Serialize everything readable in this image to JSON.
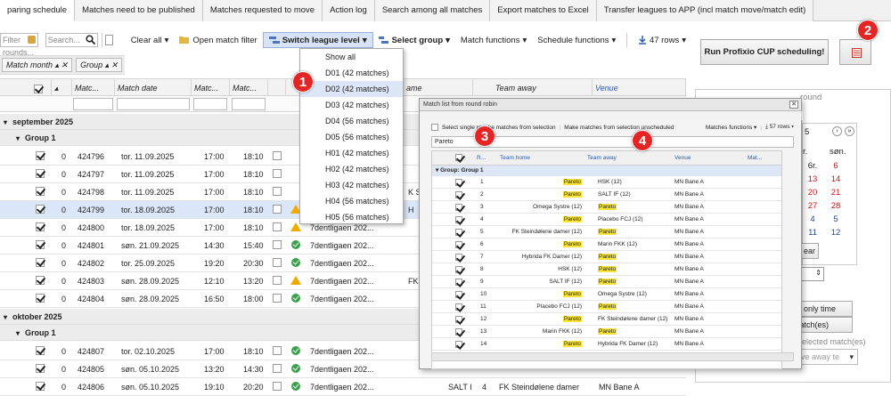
{
  "tabs": [
    "paring schedule",
    "Matches need to be published",
    "Matches requested to move",
    "Action log",
    "Search among all matches",
    "Export matches to Excel",
    "Transfer leagues to APP (incl match move/match edit)"
  ],
  "toolbar": {
    "filter_rounds_placeholder": "Filter rounds...",
    "search_placeholder": "Search...",
    "clear_all": "Clear all",
    "open_match_filter": "Open match filter",
    "switch_league_level": "Switch league level",
    "select_group": "Select group",
    "match_functions": "Match functions",
    "schedule_functions": "Schedule functions",
    "row_count": "47 rows"
  },
  "grouping": {
    "chip1": "Match month",
    "chip2": "Group"
  },
  "columns": {
    "match": "Matc...",
    "match_date": "Match date",
    "match_time": "Matc...",
    "match_end": "Matc...",
    "home_partial": "ame",
    "team_away": "Team away",
    "venue": "Venue"
  },
  "months": [
    "september 2025",
    "oktober 2025"
  ],
  "group_label": "Group 1",
  "rows": [
    {
      "n": "0",
      "id": "424796",
      "date": "tor. 11.09.2025",
      "t1": "17:00",
      "t2": "18:10",
      "status": "",
      "league": "",
      "away": ""
    },
    {
      "n": "0",
      "id": "424797",
      "date": "tor. 11.09.2025",
      "t1": "17:00",
      "t2": "18:10",
      "status": "",
      "league": "",
      "away": ""
    },
    {
      "n": "0",
      "id": "424798",
      "date": "tor. 11.09.2025",
      "t1": "17:00",
      "t2": "18:10",
      "status": "",
      "league": "",
      "away": "K Ste"
    },
    {
      "n": "0",
      "id": "424799",
      "date": "tor. 18.09.2025",
      "t1": "17:00",
      "t2": "18:10",
      "status": "warn",
      "league": "",
      "away": "H"
    },
    {
      "n": "0",
      "id": "424800",
      "date": "tor. 18.09.2025",
      "t1": "17:00",
      "t2": "18:10",
      "status": "warn",
      "league": "7dentligaen 202...",
      "away": ""
    },
    {
      "n": "0",
      "id": "424801",
      "date": "søn. 21.09.2025",
      "t1": "14:30",
      "t2": "15:40",
      "status": "ok",
      "league": "7dentligaen 202...",
      "away": ""
    },
    {
      "n": "0",
      "id": "424802",
      "date": "tor. 25.09.2025",
      "t1": "19:20",
      "t2": "20:30",
      "status": "ok",
      "league": "7dentligaen 202...",
      "away": ""
    },
    {
      "n": "0",
      "id": "424803",
      "date": "søn. 28.09.2025",
      "t1": "12:10",
      "t2": "13:20",
      "status": "warn",
      "league": "7dentligaen 202...",
      "away": "FK Ste"
    },
    {
      "n": "0",
      "id": "424804",
      "date": "søn. 28.09.2025",
      "t1": "16:50",
      "t2": "18:00",
      "status": "ok",
      "league": "7dentligaen 202...",
      "away": ""
    },
    {
      "n": "0",
      "id": "424807",
      "date": "tor. 02.10.2025",
      "t1": "17:00",
      "t2": "18:10",
      "status": "ok",
      "league": "7dentligaen 202...",
      "away": ""
    },
    {
      "n": "0",
      "id": "424805",
      "date": "søn. 05.10.2025",
      "t1": "13:20",
      "t2": "14:30",
      "status": "ok",
      "league": "7dentligaen 202...",
      "away": ""
    },
    {
      "n": "0",
      "id": "424806",
      "date": "søn. 05.10.2025",
      "t1": "19:10",
      "t2": "20:20",
      "status": "ok",
      "league": "7dentligaen 202...",
      "away": "SALT IF"
    }
  ],
  "last_row_extra": {
    "num": "4",
    "away": "FK Steindølene damer",
    "venue": "MN Bane A"
  },
  "dropdown": [
    "Show all",
    "D01 (42 matches)",
    "D02 (42 matches)",
    "D03 (42 matches)",
    "D04 (56 matches)",
    "D05 (56 matches)",
    "H01 (42 matches)",
    "H02 (42 matches)",
    "H03 (42 matches)",
    "H04 (56 matches)",
    "H05 (56 matches)"
  ],
  "badges": [
    "1",
    "2",
    "3",
    "4"
  ],
  "run_button": "Run Profixio CUP scheduling!",
  "popup": {
    "title": "Match list from round robin",
    "select_single": "Select single ro",
    "make_from_sel": "ake matches from selection",
    "make_unsched": "Make matches from selection unscheduled",
    "functions": "Matches functions",
    "rows": "57 rows",
    "search": "Pareto",
    "headers": [
      "R...",
      "Team home",
      "Team away",
      "Venue",
      "Mat..."
    ],
    "group": "Group: Group 1",
    "matches": [
      {
        "r": "1",
        "home": "Pareto",
        "away": "HSK (12)",
        "venue": "MN Bane A"
      },
      {
        "r": "2",
        "home": "Pareto",
        "away": "SALT IF (12)",
        "venue": "MN Bane A"
      },
      {
        "r": "3",
        "home": "Omega Systre (12)",
        "away": "Pareto",
        "venue": "MN Bane A"
      },
      {
        "r": "4",
        "home": "Pareto",
        "away": "Placebo FCJ (12)",
        "venue": "MN Bane A"
      },
      {
        "r": "5",
        "home": "FK Steindølene damer (12)",
        "away": "Pareto",
        "venue": "MN Bane A"
      },
      {
        "r": "6",
        "home": "Pareto",
        "away": "Marin FKK (12)",
        "venue": "MN Bane A"
      },
      {
        "r": "7",
        "home": "Hybrida FK Damer (12)",
        "away": "Pareto",
        "venue": "MN Bane A"
      },
      {
        "r": "8",
        "home": "HSK (12)",
        "away": "Pareto",
        "venue": "MN Bane A"
      },
      {
        "r": "9",
        "home": "SALT IF (12)",
        "away": "Pareto",
        "venue": "MN Bane A"
      },
      {
        "r": "10",
        "home": "Pareto",
        "away": "Omega Systre (12)",
        "venue": "MN Bane A"
      },
      {
        "r": "11",
        "home": "Placebo FCJ (12)",
        "away": "Pareto",
        "venue": "MN Bane A"
      },
      {
        "r": "12",
        "home": "Pareto",
        "away": "FK Steindølene damer (12)",
        "venue": "MN Bane A"
      },
      {
        "r": "13",
        "home": "Marin FKK (12)",
        "away": "Pareto",
        "venue": "MN Bane A"
      },
      {
        "r": "14",
        "home": "Pareto",
        "away": "Hybrida FK Damer (12)",
        "venue": "MN Bane A"
      }
    ]
  },
  "side": {
    "round_label": "round",
    "cal_day": "5",
    "cal_heads": [
      "r.",
      "søn."
    ],
    "cal": [
      [
        "6r.",
        "6"
      ],
      [
        "13",
        "14"
      ],
      [
        "20",
        "21"
      ],
      [
        "27",
        "28"
      ],
      [
        "4",
        "5"
      ],
      [
        "11",
        "12"
      ]
    ],
    "clear_btn": "ear",
    "only_time": "ve only time",
    "matches_btn": "match(es)",
    "selected_label": "elected match(es)",
    "away_placeholder": "ve away te"
  }
}
